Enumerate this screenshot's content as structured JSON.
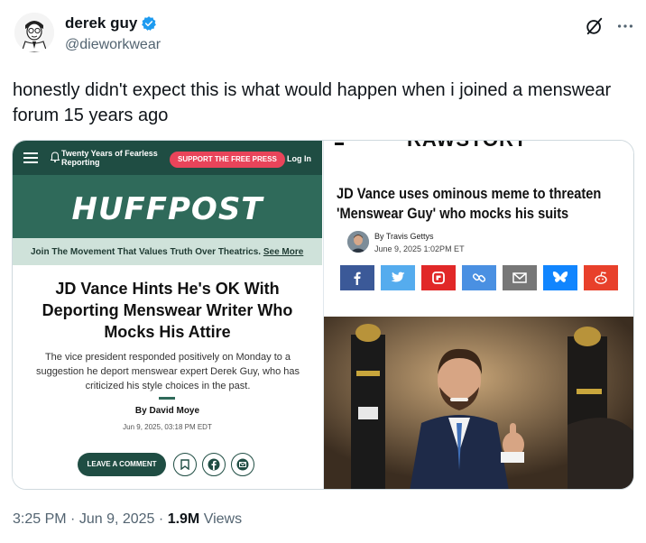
{
  "tweet": {
    "display_name": "derek guy",
    "handle": "@dieworkwear",
    "text": "honestly didn't expect this is what would happen when i joined a menswear forum 15 years ago",
    "time": "3:25 PM",
    "date": "Jun 9, 2025",
    "views_count": "1.9M",
    "views_label": "Views",
    "colors": {
      "verified": "#1d9bf0",
      "muted": "#536471"
    }
  },
  "huffpost": {
    "nav_tagline": "Twenty Years of Fearless Reporting",
    "support_button": "SUPPORT THE FREE PRESS",
    "login": "Log In",
    "logo": "HUFFPOST",
    "strip_text": "Join The Movement That Values Truth Over Theatrics.",
    "strip_link": "See More",
    "headline": "JD Vance Hints He's OK With Deporting Menswear Writer Who Mocks His Attire",
    "dek": "The vice president responded positively on Monday to a suggestion he deport menswear expert Derek Guy, who has criticized his style choices in the past.",
    "byline": "By David Moye",
    "dateline": "Jun 9, 2025, 03:18 PM EDT",
    "comment_button": "LEAVE A COMMENT",
    "icons": [
      "bookmark-icon",
      "facebook-icon",
      "email-icon"
    ],
    "colors": {
      "nav": "#1f4d43",
      "banner": "#2f6a5a",
      "strip": "#cfe2da",
      "support": "#e9445a"
    }
  },
  "rawstory": {
    "masthead": "RAWSTORY",
    "headline": "JD Vance uses ominous meme to threaten 'Menswear Guy' who mocks his suits",
    "byline": "By Travis Gettys",
    "dateline": "June 9, 2025 1:02PM ET",
    "share_buttons": [
      {
        "icon": "facebook-icon",
        "color": "#3b5998"
      },
      {
        "icon": "twitter-icon",
        "color": "#55acee"
      },
      {
        "icon": "flipboard-icon",
        "color": "#e12828"
      },
      {
        "icon": "link-icon",
        "color": "#4a90e2"
      },
      {
        "icon": "email-icon",
        "color": "#777777"
      },
      {
        "icon": "bluesky-icon",
        "color": "#1185fe"
      },
      {
        "icon": "reddit-icon",
        "color": "#e8402b"
      }
    ]
  }
}
